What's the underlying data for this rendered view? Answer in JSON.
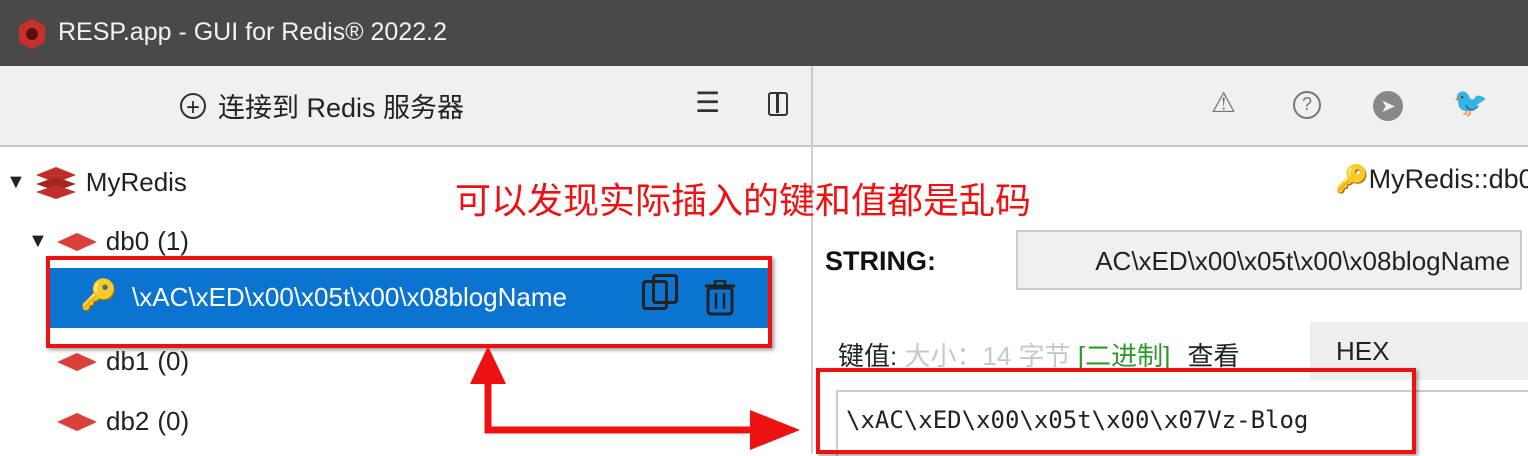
{
  "window": {
    "title": "RESP.app - GUI for Redis® 2022.2"
  },
  "toolbar": {
    "connect_label": "连接到 Redis 服务器"
  },
  "tree": {
    "connection": "MyRedis",
    "databases": [
      {
        "name": "db0",
        "count": "(1)"
      },
      {
        "name": "db1",
        "count": "(0)"
      },
      {
        "name": "db2",
        "count": "(0)"
      }
    ],
    "selected_key": "\\xAC\\xED\\x00\\x05t\\x00\\x08blogName"
  },
  "annotation": {
    "text": "可以发现实际插入的键和值都是乱码",
    "color": "#ee1111"
  },
  "editor": {
    "breadcrumb": "MyRedis::db0",
    "type_label": "STRING:",
    "key_value": "AC\\xED\\x00\\x05t\\x00\\x08blogName",
    "value_label": "键值:",
    "size_text": "大小：14 字节",
    "binary_tag": "[二进制]",
    "view_label": "查看",
    "view_mode": "HEX",
    "value": "\\xAC\\xED\\x00\\x05t\\x00\\x07Vz-Blog"
  }
}
